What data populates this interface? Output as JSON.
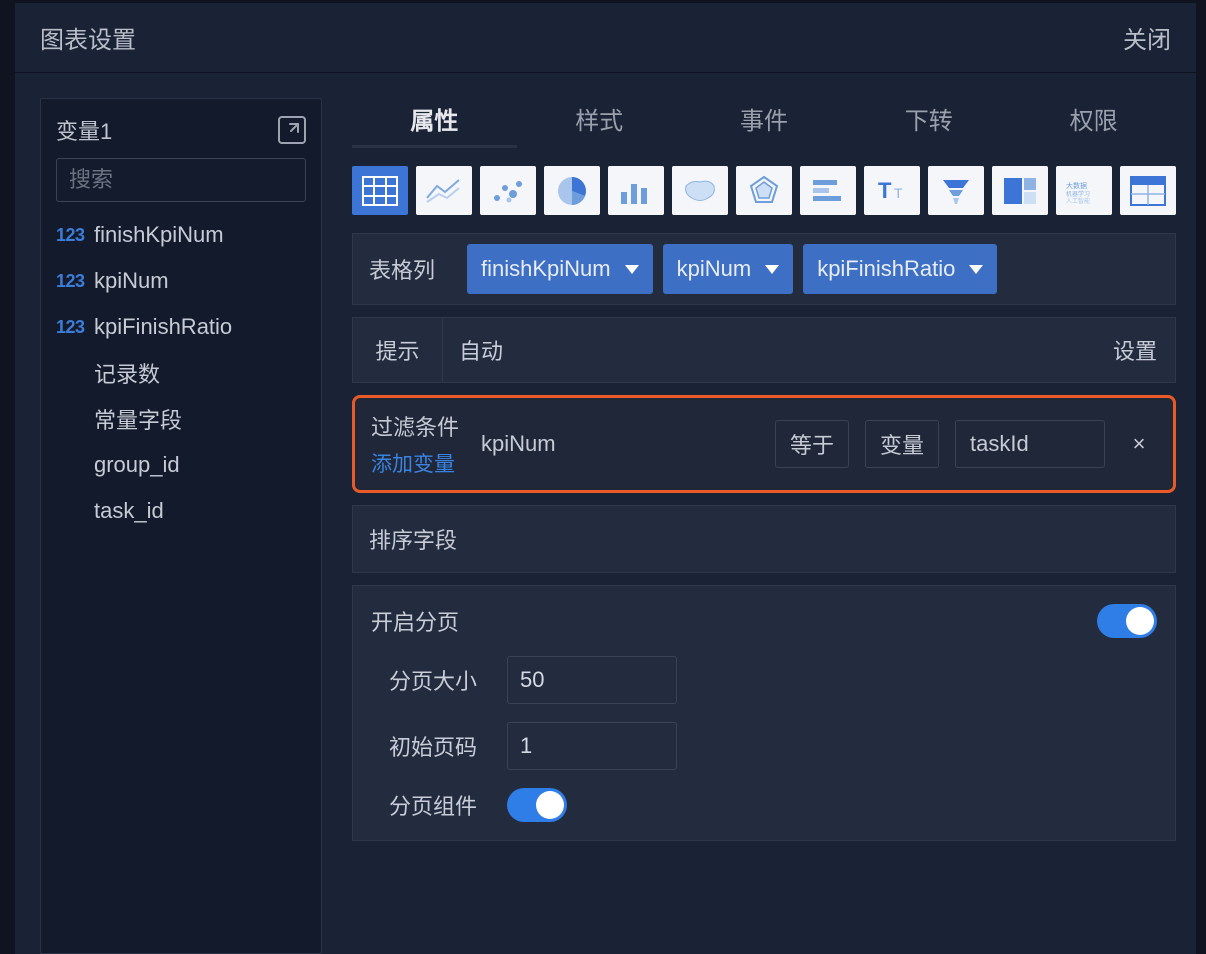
{
  "header": {
    "title": "图表设置",
    "close": "关闭"
  },
  "sidebar": {
    "title": "变量1",
    "search_placeholder": "搜索",
    "items": [
      {
        "prefix": "123",
        "label": "finishKpiNum"
      },
      {
        "prefix": "123",
        "label": "kpiNum"
      },
      {
        "prefix": "123",
        "label": "kpiFinishRatio"
      },
      {
        "prefix": "",
        "label": "记录数"
      },
      {
        "prefix": "",
        "label": "常量字段"
      },
      {
        "prefix": "",
        "label": "group_id"
      },
      {
        "prefix": "",
        "label": "task_id"
      }
    ]
  },
  "tabs": [
    "属性",
    "样式",
    "事件",
    "下转",
    "权限"
  ],
  "chart_type_names": [
    "table",
    "line",
    "scatter",
    "pie",
    "bar",
    "map",
    "radar",
    "horizontal-bar",
    "text",
    "funnel",
    "treemap",
    "wordcloud",
    "table-alt"
  ],
  "columns": {
    "label": "表格列",
    "items": [
      "finishKpiNum",
      "kpiNum",
      "kpiFinishRatio"
    ]
  },
  "tooltip": {
    "label": "提示",
    "value": "自动",
    "action": "设置"
  },
  "filter": {
    "label": "过滤条件",
    "add": "添加变量",
    "field": "kpiNum",
    "op": "等于",
    "mode": "变量",
    "target": "taskId",
    "remove": "×"
  },
  "sort": {
    "label": "排序字段"
  },
  "pagination": {
    "enable_label": "开启分页",
    "page_size_label": "分页大小",
    "page_size_value": "50",
    "start_page_label": "初始页码",
    "start_page_value": "1",
    "component_label": "分页组件"
  }
}
